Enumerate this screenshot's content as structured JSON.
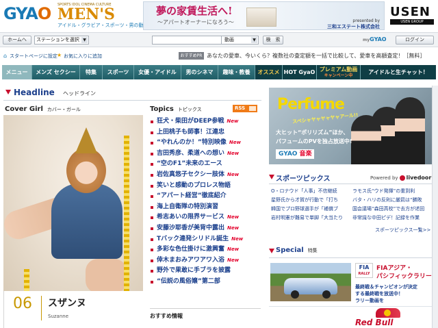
{
  "header": {
    "logo_gyao_left": "GYA",
    "logo_gyao_right": "O",
    "logo_mens_tagline": "SPORTS IDOL CINEMA CULTURE",
    "logo_mens": "MEN'S",
    "logo_mens_sub": "アイドル・グラビア・スポーツ・男の動画",
    "banner_main": "夢の家賃生活へ!",
    "banner_sub": "～アパートオーナーになろう～",
    "banner_presented": "presented by",
    "banner_sponsor": "三和エステート株式会社",
    "usen_logo": "USEN",
    "usen_group": "USEN GROUP"
  },
  "searchbar": {
    "home_label": "ホームへ",
    "station_select": "ステーションを選択",
    "search_type": "動画",
    "search_button": "検　索",
    "my_prefix": "my",
    "my_gyao": "GYAO",
    "login_button": "ログイン"
  },
  "util": {
    "start_page": "スタートページに設定",
    "favorites": "お気に入りに追加",
    "pr_badge": "おすすめPR",
    "pr_text": "あなたの愛車、今いくら？複数社の査定額を一括で比較して、愛車を高額査定！［無料］"
  },
  "nav": {
    "items": [
      {
        "label": "メニュー"
      },
      {
        "label": "メンズ セクシー"
      },
      {
        "label": "特集"
      },
      {
        "label": "スポーツ"
      },
      {
        "label": "女優・アイドル"
      },
      {
        "label": "男のシネマ"
      },
      {
        "label": "趣味・教養"
      },
      {
        "label": "オススメ"
      },
      {
        "label": "HOT GyaO"
      },
      {
        "label": "プレミアム動画",
        "sub": "キャンペーン中"
      },
      {
        "label": "アイドルと生チャット！"
      }
    ]
  },
  "headline": {
    "title": "Headline",
    "subtitle": "ヘッドライン"
  },
  "cover_girl": {
    "title": "Cover Girl",
    "subtitle": "カバー・ガール",
    "number": "06",
    "name": "スザンヌ",
    "name_en": "Suzanne"
  },
  "topics": {
    "title": "Topics",
    "subtitle": "トピックス",
    "rss_label": "RSS",
    "new_label": "New",
    "items": [
      {
        "text": "狂犬・柴田がDEEP参戦",
        "new": true
      },
      {
        "text": "上田桃子も師事！江連忠",
        "new": false
      },
      {
        "text": "“やれんのか！”特別映像",
        "new": true
      },
      {
        "text": "吉田秀彦、柔道への想い",
        "new": true
      },
      {
        "text": "“空のF1”未来のエース",
        "new": false
      },
      {
        "text": "岩佐真悠子セクシー肢体",
        "new": true
      },
      {
        "text": "笑いと感動のプロレス物語",
        "new": false
      },
      {
        "text": "“アパート経営”徹底紹介",
        "new": false
      },
      {
        "text": "海上自衛隊の特別演習",
        "new": false
      },
      {
        "text": "希志あいの限界サービス",
        "new": true
      },
      {
        "text": "安藤沙耶香が美背中露出",
        "new": true
      },
      {
        "text": "Tバック連発シリドル誕生",
        "new": true
      },
      {
        "text": "多彩な色仕掛けに激興奮",
        "new": true
      },
      {
        "text": "倖木まおみアワアワ入浴",
        "new": true
      },
      {
        "text": "野外で果敢に手ブラを披露",
        "new": false
      },
      {
        "text": "“伝説の風俗嬢”第二部",
        "new": false
      }
    ],
    "recommend_title": "おすすめ情報"
  },
  "perfume": {
    "title": "Perfume",
    "sub": "スペシャヤャヤャヤャアール!!",
    "desc1": "大ヒット“ポリリズム”ほか、",
    "desc2": "パフュームのPVを独占放送中!",
    "gyao": "GYAO",
    "ongaku": "音楽"
  },
  "sports": {
    "title": "スポーツピックス",
    "powered_by": "Powered by",
    "provider": "livedoor",
    "left_items": [
      "O・ロナウド「人事」不信継続",
      "星野氏から才賀が行動で「打ち",
      "韓国でプロ野球選手が「補償ブ",
      "岩村明憲が難易で単脚「大当たり"
    ],
    "right_items": [
      "ラモス氏“ウド発揮”の重到利",
      "バタ・ハリの反則に厳罰は“勝敗",
      "国会議場“森田高校”で去方が述回",
      "非常識な中田ピデ！記録を作業"
    ],
    "more": "スポーツピックス一覧>>"
  },
  "special": {
    "title": "Special",
    "subtitle": "特集",
    "fia_logo": "FIA",
    "fia_logo_sub": "RALLY",
    "fia_title1": "FIAアジア・",
    "fia_title2": "パシフィックラリー",
    "fia_desc1": "最終戦＆チャンピオンが決定",
    "fia_desc2": "する最終戦を放送中！",
    "fia_desc3": "ラリー動画を",
    "redbull": "Red Bull"
  },
  "colors": {
    "brand_blue": "#1a7ab5",
    "mens_gold": "#d98a00",
    "nav_teal": "#2e6e77",
    "accent_red": "#c8102e",
    "link_blue": "#1a3f8c"
  }
}
